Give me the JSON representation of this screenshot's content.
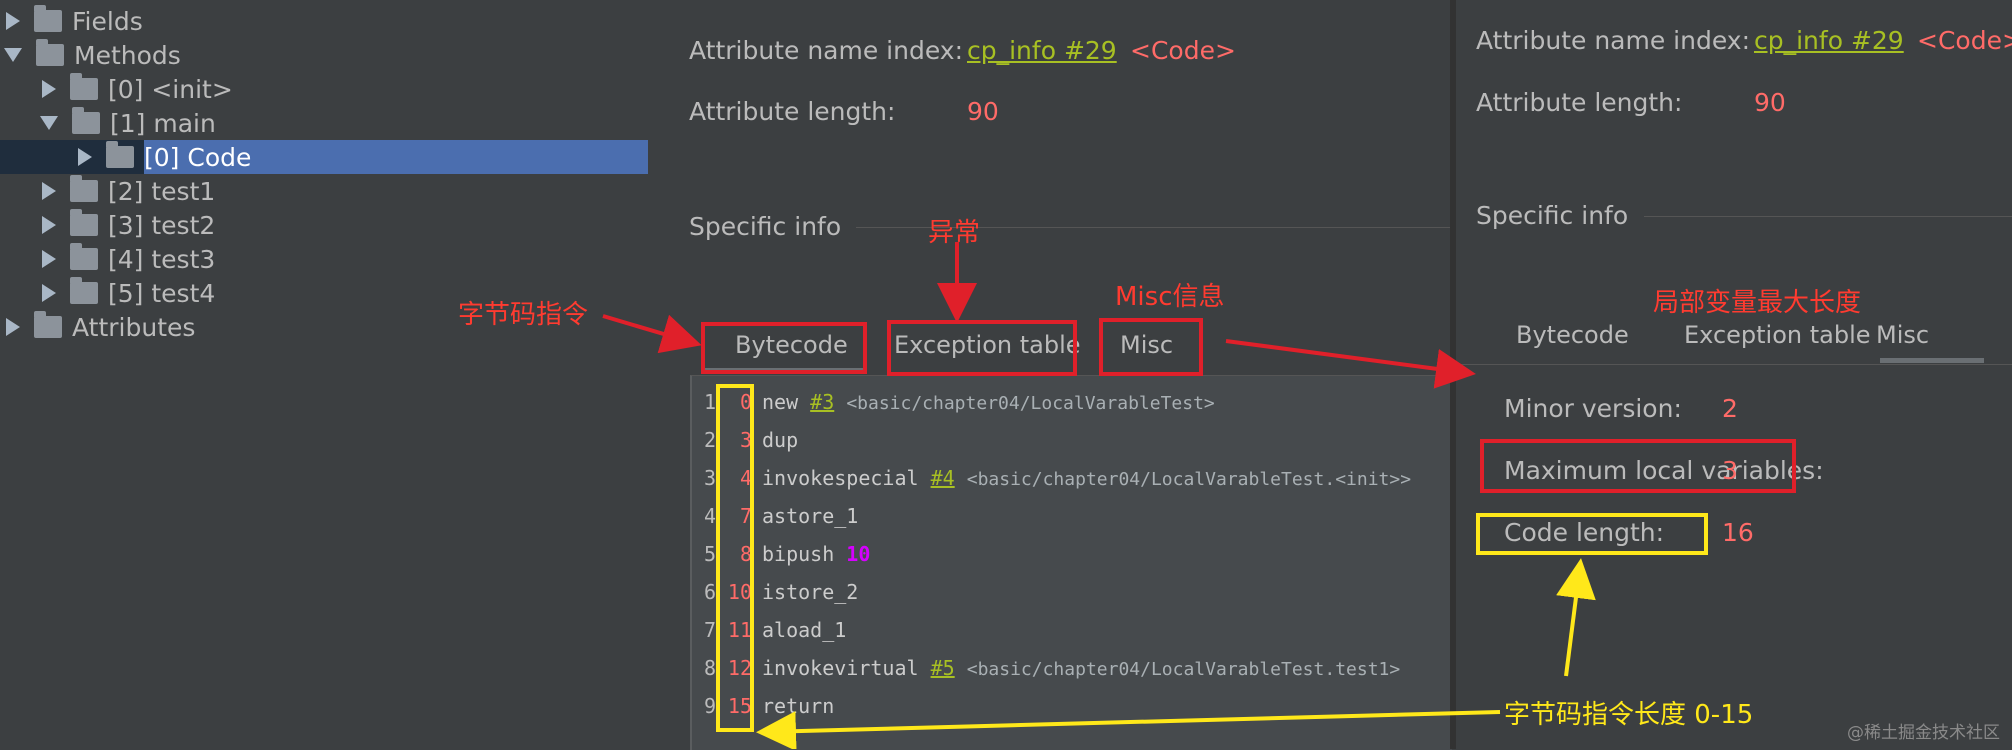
{
  "tree": {
    "items": [
      {
        "label": "Fields",
        "expanded": false
      },
      {
        "label": "Methods",
        "expanded": true
      },
      {
        "label": "[0] <init>",
        "expanded": false
      },
      {
        "label": "[1] main",
        "expanded": true
      },
      {
        "label": "[0] Code",
        "expanded": false,
        "selected": true
      },
      {
        "label": "[2] test1",
        "expanded": false
      },
      {
        "label": "[3] test2",
        "expanded": false
      },
      {
        "label": "[4] test3",
        "expanded": false
      },
      {
        "label": "[5] test4",
        "expanded": false
      },
      {
        "label": "Attributes",
        "expanded": false
      }
    ]
  },
  "left_panel": {
    "attr_name_index_label": "Attribute name index:",
    "attr_name_index_link": "cp_info #29",
    "attr_name_index_value": "<Code>",
    "attr_length_label": "Attribute length:",
    "attr_length_value": "90",
    "specific_info": "Specific info",
    "tabs": [
      "Bytecode",
      "Exception table",
      "Misc"
    ],
    "code_lines": [
      {
        "ln": "1",
        "offset": "0",
        "op": "new",
        "ref": "#3",
        "comment": "<basic/chapter04/LocalVarableTest>"
      },
      {
        "ln": "2",
        "offset": "3",
        "op": "dup"
      },
      {
        "ln": "3",
        "offset": "4",
        "op": "invokespecial",
        "ref": "#4",
        "comment": "<basic/chapter04/LocalVarableTest.<init>>"
      },
      {
        "ln": "4",
        "offset": "7",
        "op": "astore_1"
      },
      {
        "ln": "5",
        "offset": "8",
        "op": "bipush",
        "num": "10"
      },
      {
        "ln": "6",
        "offset": "10",
        "op": "istore_2"
      },
      {
        "ln": "7",
        "offset": "11",
        "op": "aload_1"
      },
      {
        "ln": "8",
        "offset": "12",
        "op": "invokevirtual",
        "ref": "#5",
        "comment": "<basic/chapter04/LocalVarableTest.test1>"
      },
      {
        "ln": "9",
        "offset": "15",
        "op": "return"
      }
    ]
  },
  "right_panel": {
    "attr_name_index_label": "Attribute name index:",
    "attr_name_index_link": "cp_info #29",
    "attr_name_index_value": "<Code>",
    "attr_length_label": "Attribute length:",
    "attr_length_value": "90",
    "specific_info": "Specific info",
    "tabs": [
      "Bytecode",
      "Exception table",
      "Misc"
    ],
    "active_tab": "Misc",
    "minor_version_label": "Minor version:",
    "minor_version_value": "2",
    "max_locals_label": "Maximum local variables:",
    "max_locals_value": "3",
    "code_length_label": "Code length:",
    "code_length_value": "16"
  },
  "annotations": {
    "bytecode_instr": "字节码指令",
    "exception": "异常",
    "misc_info": "Misc信息",
    "max_local_len": "局部变量最大长度",
    "bytecode_len": "字节码指令长度 0-15"
  },
  "watermark": "@稀土掘金技术社区",
  "colors": {
    "background": "#3c3f41",
    "selection": "#4b6eaf",
    "link": "#a8c023",
    "value_red": "#ff6b68",
    "annotation_red": "#e0202a",
    "annotation_yellow": "#ffe81a"
  }
}
